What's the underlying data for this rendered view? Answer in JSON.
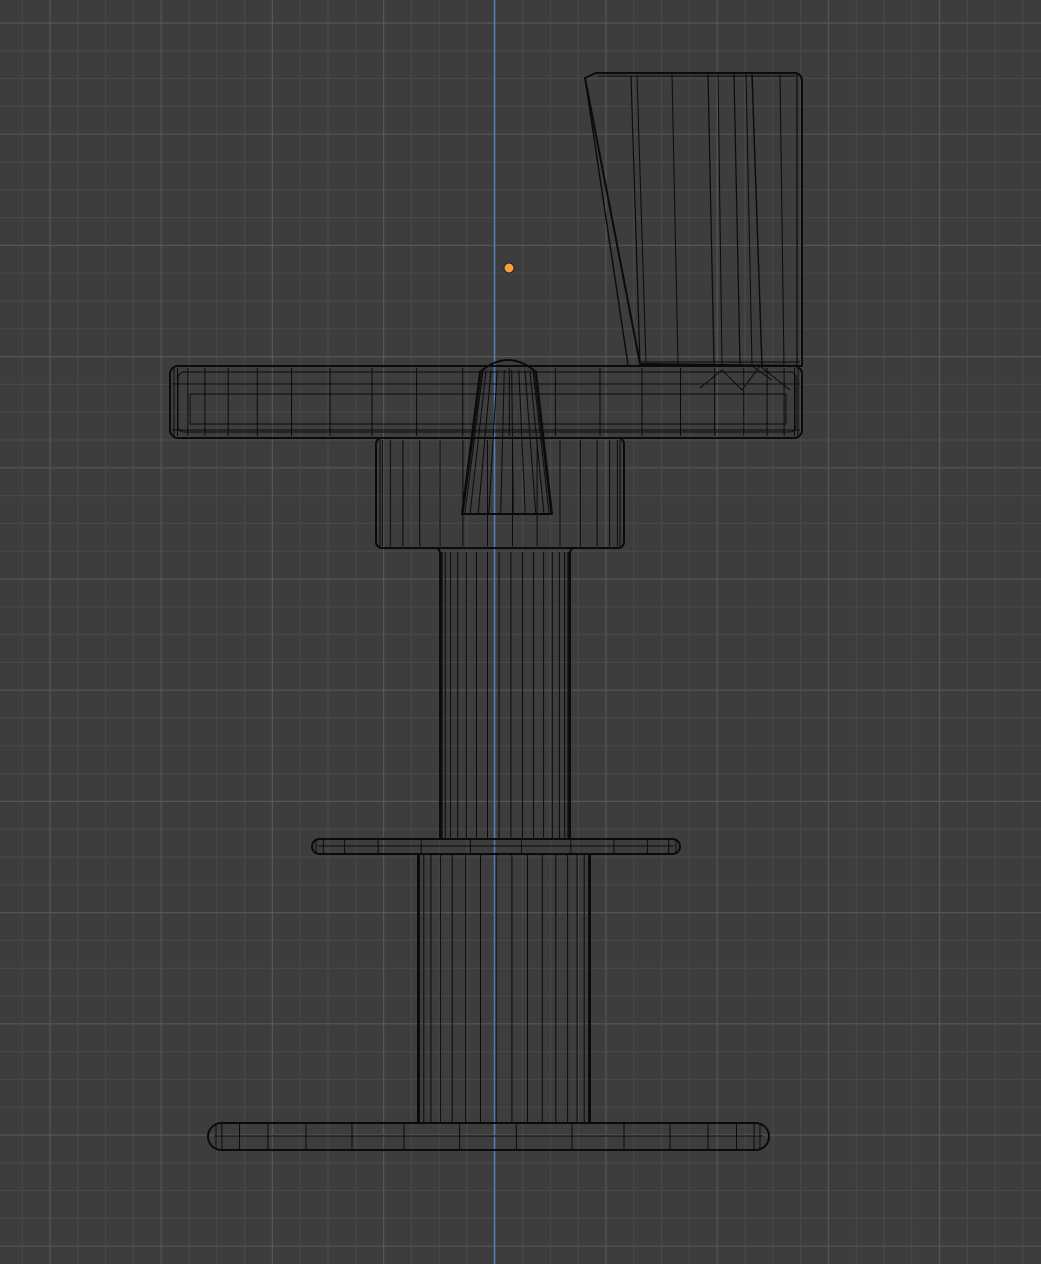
{
  "viewport": {
    "view": "orthographic-side",
    "shading": "wireframe",
    "grid": true,
    "colors": {
      "background": "#3d3d3d",
      "grid_minor": "#4a4a4a",
      "grid_major": "#565656",
      "z_axis": "#4f7fbf",
      "wire": "#0b0b0b",
      "origin": "#f5a03c"
    }
  },
  "scene": {
    "object": {
      "icon": "bar-stool-icon",
      "parts": [
        "backrest",
        "seat",
        "seat-hub",
        "seat-cone",
        "upper-column",
        "footrest-ring",
        "lower-column",
        "base-disc"
      ]
    },
    "origin": {
      "icon": "object-origin-icon"
    }
  }
}
